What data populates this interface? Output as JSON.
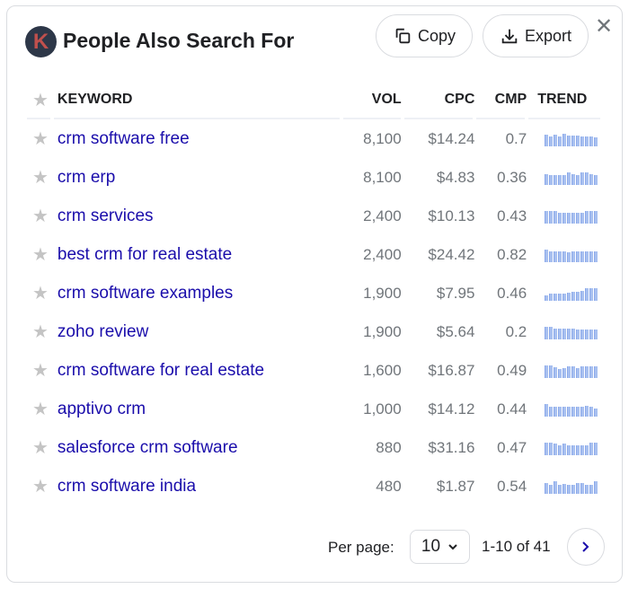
{
  "header": {
    "logo_letter": "K",
    "title": "People Also Search For",
    "copy_label": "Copy",
    "export_label": "Export",
    "close_glyph": "✕"
  },
  "table": {
    "columns": {
      "keyword": "KEYWORD",
      "vol": "VOL",
      "cpc": "CPC",
      "cmp": "CMP",
      "trend": "TREND"
    },
    "rows": [
      {
        "keyword": "crm software free",
        "vol": "8,100",
        "cpc": "$14.24",
        "cmp": "0.7",
        "trend": [
          0.85,
          0.7,
          0.85,
          0.7,
          0.9,
          0.8,
          0.8,
          0.8,
          0.75,
          0.75,
          0.75,
          0.65
        ]
      },
      {
        "keyword": "crm erp",
        "vol": "8,100",
        "cpc": "$4.83",
        "cmp": "0.36",
        "trend": [
          0.8,
          0.75,
          0.75,
          0.75,
          0.75,
          0.9,
          0.8,
          0.75,
          0.9,
          0.9,
          0.8,
          0.75
        ]
      },
      {
        "keyword": "crm services",
        "vol": "2,400",
        "cpc": "$10.13",
        "cmp": "0.43",
        "trend": [
          0.95,
          0.95,
          0.95,
          0.8,
          0.8,
          0.8,
          0.8,
          0.8,
          0.8,
          0.95,
          0.95,
          0.95
        ]
      },
      {
        "keyword": "best crm for real estate",
        "vol": "2,400",
        "cpc": "$24.42",
        "cmp": "0.82",
        "trend": [
          0.95,
          0.8,
          0.8,
          0.8,
          0.8,
          0.7,
          0.8,
          0.8,
          0.8,
          0.8,
          0.8,
          0.8
        ]
      },
      {
        "keyword": "crm software examples",
        "vol": "1,900",
        "cpc": "$7.95",
        "cmp": "0.46",
        "trend": [
          0.4,
          0.5,
          0.5,
          0.5,
          0.5,
          0.6,
          0.65,
          0.65,
          0.75,
          0.9,
          0.9,
          0.9
        ]
      },
      {
        "keyword": "zoho review",
        "vol": "1,900",
        "cpc": "$5.64",
        "cmp": "0.2",
        "trend": [
          0.95,
          0.95,
          0.8,
          0.8,
          0.8,
          0.8,
          0.8,
          0.75,
          0.75,
          0.75,
          0.75,
          0.75
        ]
      },
      {
        "keyword": "crm software for real estate",
        "vol": "1,600",
        "cpc": "$16.87",
        "cmp": "0.49",
        "trend": [
          0.9,
          0.9,
          0.8,
          0.65,
          0.7,
          0.85,
          0.85,
          0.7,
          0.85,
          0.85,
          0.85,
          0.85
        ]
      },
      {
        "keyword": "apptivo crm",
        "vol": "1,000",
        "cpc": "$14.12",
        "cmp": "0.44",
        "trend": [
          0.95,
          0.7,
          0.7,
          0.7,
          0.7,
          0.7,
          0.7,
          0.7,
          0.7,
          0.8,
          0.75,
          0.6
        ]
      },
      {
        "keyword": "salesforce crm software",
        "vol": "880",
        "cpc": "$31.16",
        "cmp": "0.47",
        "trend": [
          0.95,
          0.95,
          0.85,
          0.7,
          0.85,
          0.7,
          0.7,
          0.7,
          0.7,
          0.7,
          0.9,
          0.9
        ]
      },
      {
        "keyword": "crm software india",
        "vol": "480",
        "cpc": "$1.87",
        "cmp": "0.54",
        "trend": [
          0.8,
          0.65,
          0.9,
          0.65,
          0.75,
          0.65,
          0.65,
          0.8,
          0.8,
          0.65,
          0.65,
          0.95
        ]
      }
    ]
  },
  "footer": {
    "per_page_label": "Per page:",
    "per_page_value": "10",
    "range_text": "1-10 of 41"
  },
  "colors": {
    "link": "#1a0dab",
    "trend_bar": "#a8c0f0",
    "logo_bg": "#2d3748",
    "logo_letter": "#c0504d"
  }
}
